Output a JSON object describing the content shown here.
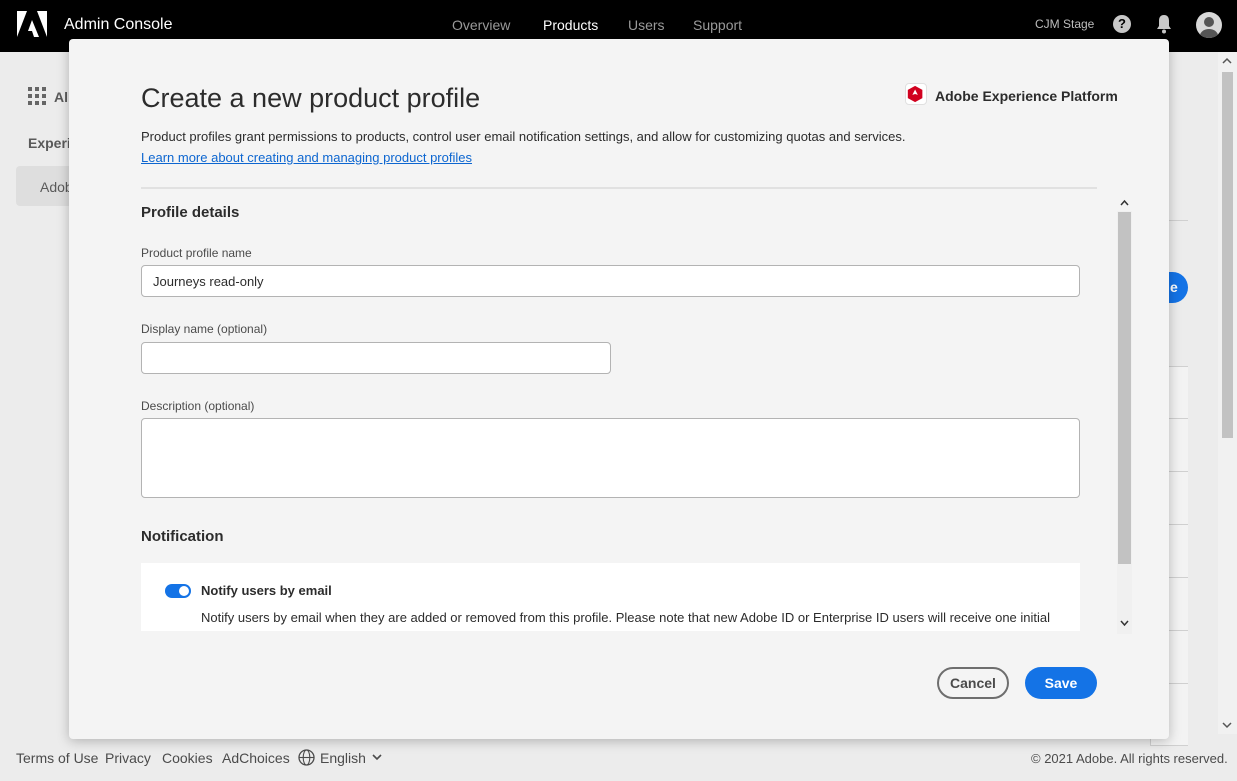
{
  "topbar": {
    "app_title": "Admin Console",
    "nav": [
      {
        "label": "Overview",
        "active": false
      },
      {
        "label": "Products",
        "active": true
      },
      {
        "label": "Users",
        "active": false
      },
      {
        "label": "Support",
        "active": false
      }
    ],
    "org_name": "CJM Stage",
    "help_glyph": "?"
  },
  "background": {
    "all_products_label": "All",
    "section_label": "Experie",
    "sidebar_item": "Adob",
    "button_fragment": "e"
  },
  "modal": {
    "title": "Create a new product profile",
    "product_name": "Adobe Experience Platform",
    "description": "Product profiles grant permissions to products, control user email notification settings, and allow for customizing quotas and services.",
    "learn_more": "Learn more about creating and managing product profiles",
    "profile_details": {
      "heading": "Profile details",
      "name_label": "Product profile name",
      "name_value": "Journeys read-only",
      "display_label": "Display name (optional)",
      "display_value": "",
      "description_label": "Description (optional)",
      "description_value": ""
    },
    "notification": {
      "heading": "Notification",
      "toggle_on": true,
      "toggle_label": "Notify users by email",
      "toggle_text": "Notify users by email when they are added or removed from this profile. Please note that new Adobe ID or Enterprise ID users will receive one initial"
    },
    "cancel_label": "Cancel",
    "save_label": "Save"
  },
  "footer": {
    "links": [
      "Terms of Use",
      "Privacy",
      "Cookies",
      "AdChoices"
    ],
    "language": "English",
    "copyright": "© 2021 Adobe. All rights reserved."
  },
  "colors": {
    "accent": "#1473e6",
    "topbar": "#000000",
    "link": "#0d66d0"
  }
}
